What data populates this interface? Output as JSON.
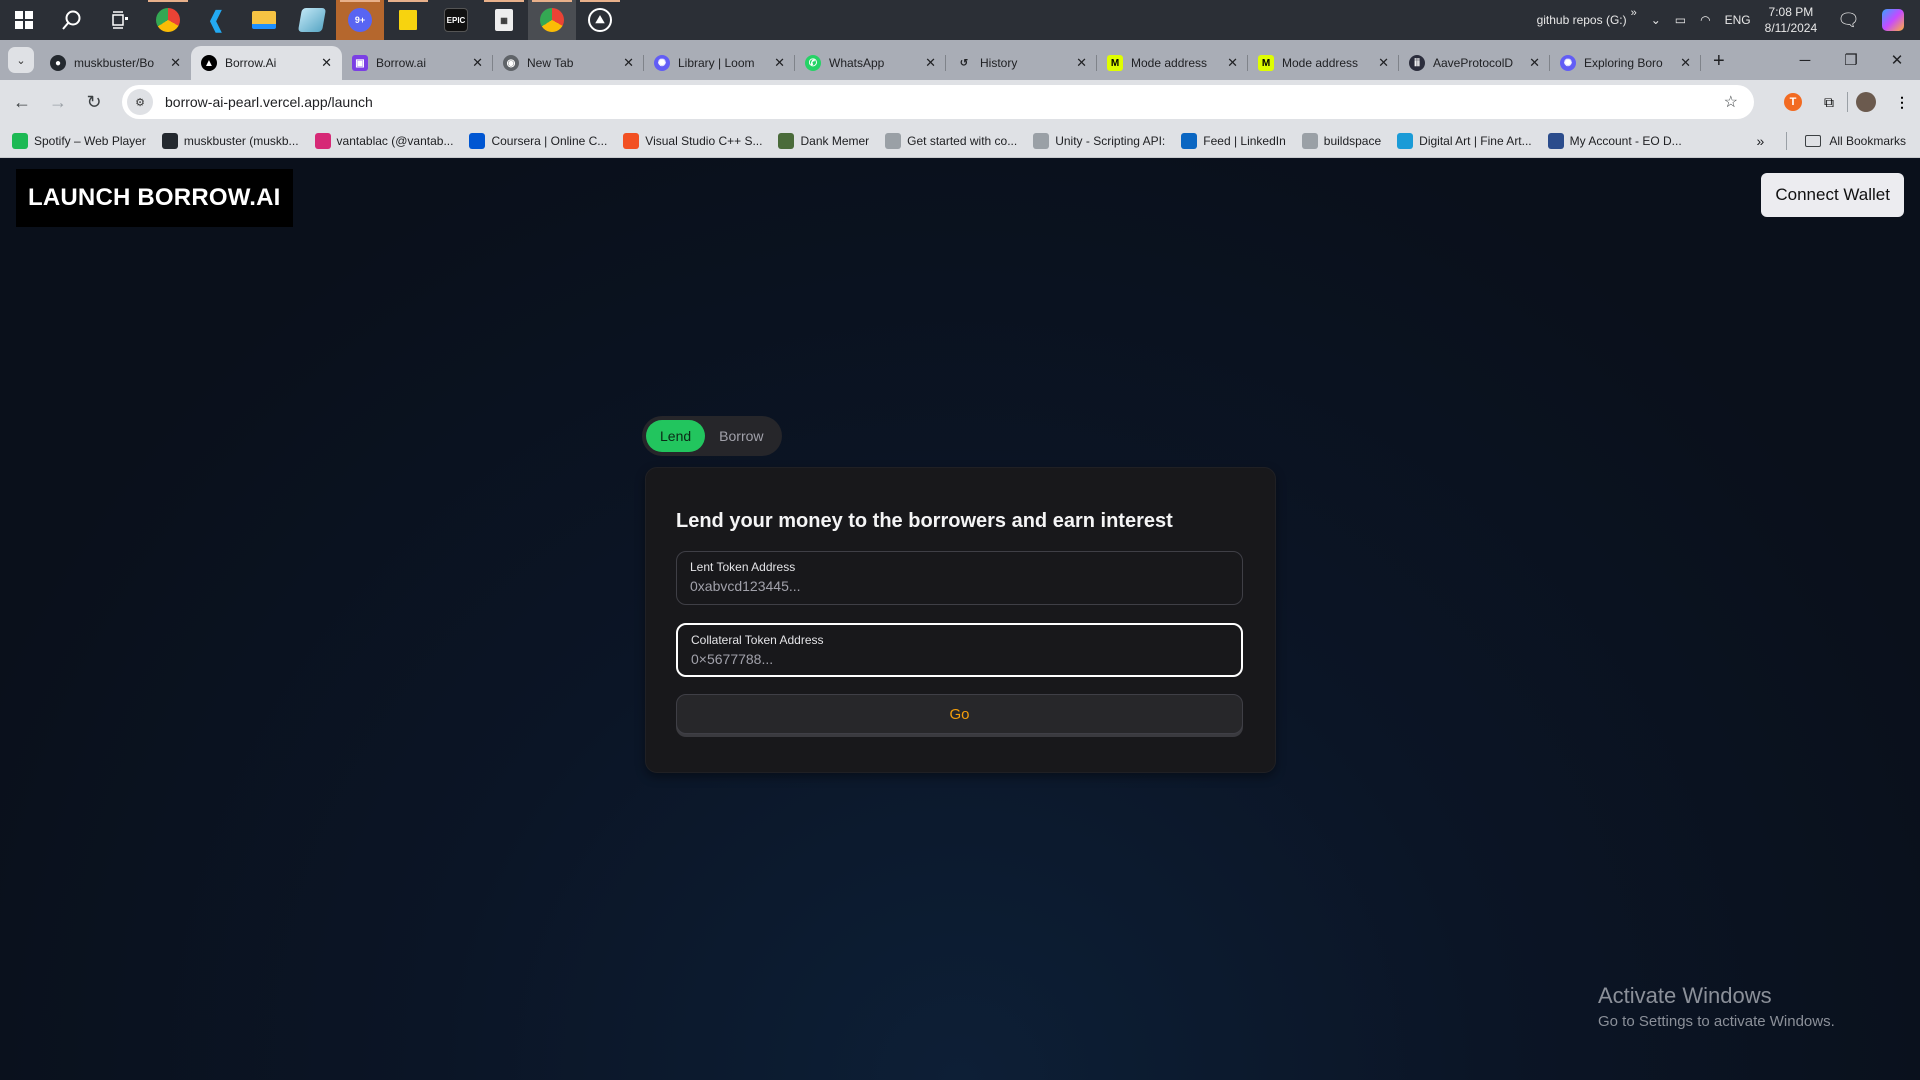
{
  "taskbar": {
    "apps": [
      {
        "name": "start",
        "icon": "windows-icon"
      },
      {
        "name": "search",
        "icon": "search-icon"
      },
      {
        "name": "task-view",
        "icon": "task-view-icon"
      },
      {
        "name": "chrome-profile-1",
        "icon": "chrome-icon"
      },
      {
        "name": "vscode",
        "icon": "vscode-icon"
      },
      {
        "name": "file-explorer",
        "icon": "folder-icon"
      },
      {
        "name": "notepad",
        "icon": "notepad-icon"
      },
      {
        "name": "discord",
        "icon": "discord-icon",
        "badge": "9+"
      },
      {
        "name": "sticky-notes",
        "icon": "sticky-notes-icon"
      },
      {
        "name": "epic-games",
        "icon": "epic-games-icon",
        "label": "EPIC"
      },
      {
        "name": "calculator",
        "icon": "calculator-icon"
      },
      {
        "name": "chrome-profile-2",
        "icon": "chrome-icon"
      },
      {
        "name": "photos",
        "icon": "photos-icon"
      }
    ],
    "tray": {
      "drive": "github repos (G:)",
      "overflow": "»",
      "language": "ENG",
      "time": "7:08 PM",
      "date": "8/11/2024"
    }
  },
  "browser": {
    "tabs": [
      {
        "title": "muskbuster/Bo",
        "icon": "github-icon",
        "active": false
      },
      {
        "title": "Borrow.Ai",
        "icon": "vercel-icon",
        "active": true
      },
      {
        "title": "Borrow.ai",
        "icon": "presentation-icon",
        "active": false
      },
      {
        "title": "New Tab",
        "icon": "chrome-icon",
        "active": false
      },
      {
        "title": "Library | Loom",
        "icon": "loom-icon",
        "active": false
      },
      {
        "title": "WhatsApp",
        "icon": "whatsapp-icon",
        "active": false
      },
      {
        "title": "History",
        "icon": "history-icon",
        "active": false
      },
      {
        "title": "Mode address",
        "icon": "mode-icon",
        "active": false
      },
      {
        "title": "Mode address",
        "icon": "mode-icon",
        "active": false
      },
      {
        "title": "AaveProtocolD",
        "icon": "aave-icon",
        "active": false
      },
      {
        "title": "Exploring Boro",
        "icon": "loom-icon",
        "active": false
      }
    ],
    "new_tab": "+",
    "url": "borrow-ai-pearl.vercel.app/launch",
    "bookmarks": [
      {
        "label": "Spotify – Web Player",
        "icon": "spotify-icon",
        "color": "#1db954"
      },
      {
        "label": "muskbuster (muskb...",
        "icon": "github-icon",
        "color": "#24292f"
      },
      {
        "label": "vantablac (@vantab...",
        "icon": "instagram-icon",
        "color": "#d62976"
      },
      {
        "label": "Coursera | Online C...",
        "icon": "coursera-icon",
        "color": "#0056d2"
      },
      {
        "label": "Visual Studio C++ S...",
        "icon": "microsoft-icon",
        "color": "#f25022"
      },
      {
        "label": "Dank Memer",
        "icon": "dank-memer-icon",
        "color": "#4a6b3a"
      },
      {
        "label": "Get started with co...",
        "icon": "unity-icon",
        "color": "#9aa0a6"
      },
      {
        "label": "Unity - Scripting API:",
        "icon": "unity-icon",
        "color": "#9aa0a6"
      },
      {
        "label": "Feed | LinkedIn",
        "icon": "linkedin-icon",
        "color": "#0a66c2"
      },
      {
        "label": "buildspace",
        "icon": "buildspace-icon",
        "color": "#9aa0a6"
      },
      {
        "label": "Digital Art | Fine Art...",
        "icon": "digital-art-icon",
        "color": "#1a9bd7"
      },
      {
        "label": "My Account - EO D...",
        "icon": "eo-icon",
        "color": "#2b4c8c"
      }
    ],
    "bookmarks_more": "»",
    "all_bookmarks": "All Bookmarks"
  },
  "page": {
    "brand": "LAUNCH BORROW.AI",
    "connect_wallet": "Connect Wallet",
    "mode_tabs": [
      {
        "label": "Lend",
        "active": true
      },
      {
        "label": "Borrow",
        "active": false
      }
    ],
    "card": {
      "heading": "Lend your money to the borrowers and earn interest",
      "fields": [
        {
          "label": "Lent Token Address",
          "placeholder": "0xabvcd123445...",
          "value": ""
        },
        {
          "label": "Collateral Token Address",
          "placeholder": "0×5677788...",
          "value": ""
        }
      ],
      "submit": "Go"
    },
    "colors": {
      "accent_green": "#22c55e",
      "go_text": "#f59e0b",
      "card_bg": "#18181b"
    }
  },
  "watermark": {
    "title": "Activate Windows",
    "subtitle": "Go to Settings to activate Windows."
  }
}
